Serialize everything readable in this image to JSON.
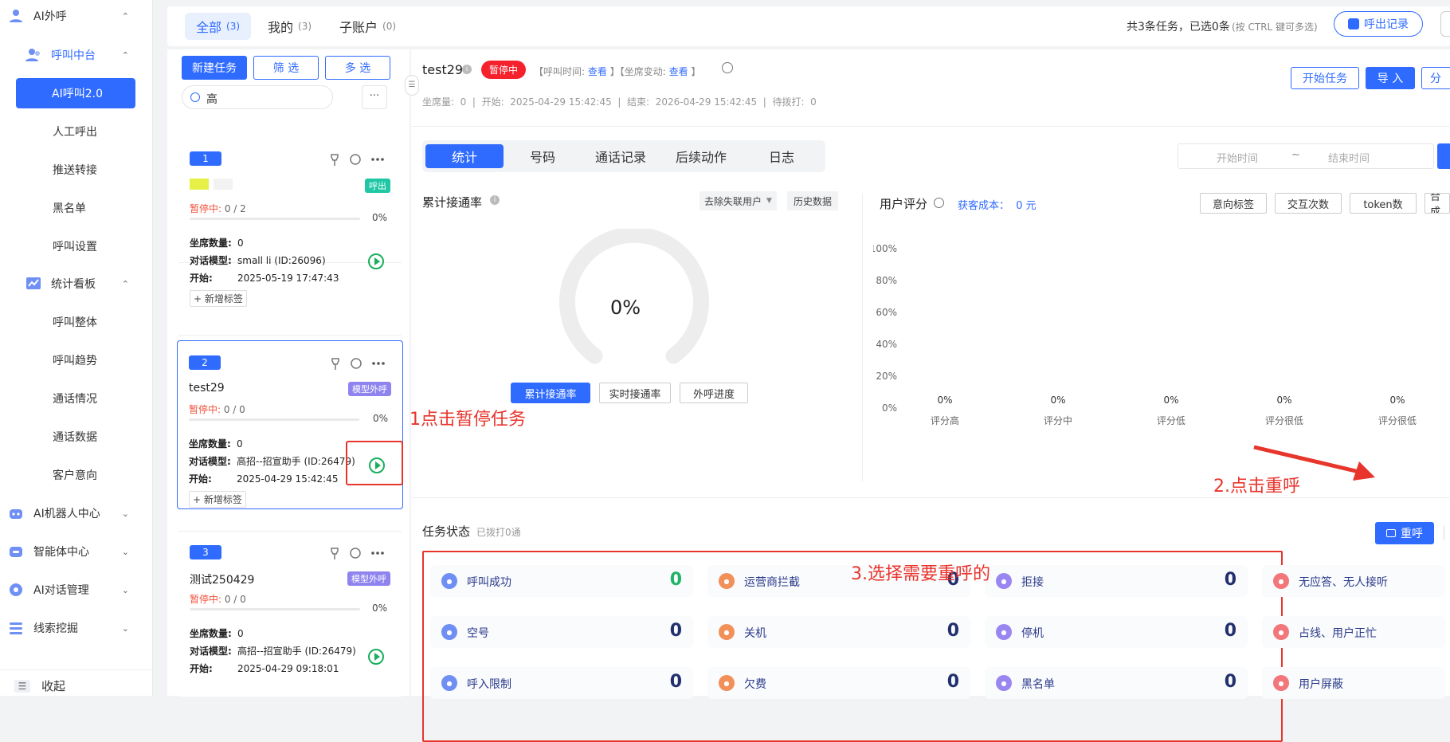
{
  "sidebar": {
    "items": [
      {
        "label": "AI外呼",
        "chev": "⌃",
        "icon": "person-icon"
      },
      {
        "label": "呼叫中台",
        "chev": "⌃",
        "icon": "people-icon"
      },
      {
        "label": "AI呼叫2.0"
      },
      {
        "label": "人工呼出"
      },
      {
        "label": "推送转接"
      },
      {
        "label": "黑名单"
      },
      {
        "label": "呼叫设置"
      },
      {
        "label": "统计看板",
        "chev": "⌃",
        "icon": "chart-icon"
      },
      {
        "label": "呼叫整体"
      },
      {
        "label": "呼叫趋势"
      },
      {
        "label": "通话情况"
      },
      {
        "label": "通话数据"
      },
      {
        "label": "客户意向"
      },
      {
        "label": "AI机器人中心",
        "chev": "⌄",
        "icon": "robot-icon"
      },
      {
        "label": "智能体中心",
        "chev": "⌄",
        "icon": "agent-icon"
      },
      {
        "label": "AI对话管理",
        "chev": "⌄",
        "icon": "dialog-icon"
      },
      {
        "label": "线索挖掘",
        "chev": "⌄",
        "icon": "mining-icon"
      }
    ],
    "collapse": "收起"
  },
  "topbar": {
    "tabs": [
      {
        "label": "全部",
        "count": "(3)"
      },
      {
        "label": "我的",
        "count": "(3)"
      },
      {
        "label": "子账户",
        "count": "(0)"
      }
    ],
    "summary": "共3条任务，已选0条",
    "hint": "(按 CTRL 键可多选)",
    "record_btn": "呼出记录"
  },
  "list": {
    "new_task": "新建任务",
    "filter": "筛 选",
    "multi": "多 选",
    "search_value": "高",
    "more": "···",
    "cards": [
      {
        "num": "1",
        "name": "",
        "tag": "呼出",
        "status_label": "暂停中:",
        "status_value": " 0 / 2",
        "pct": "0%",
        "seats_label": "坐席数量:",
        "seats": "0",
        "model_label": "对话模型:",
        "model": "small li (ID:26096)",
        "start_label": "开始:",
        "start": "2025-05-19 17:47:43",
        "addtag": "+ 新增标签"
      },
      {
        "num": "2",
        "name": "test29",
        "tag": "模型外呼",
        "status_label": "暂停中:",
        "status_value": " 0 / 0",
        "pct": "0%",
        "seats_label": "坐席数量:",
        "seats": "0",
        "model_label": "对话模型:",
        "model": "高招--招宣助手 (ID:26479)",
        "start_label": "开始:",
        "start": "2025-04-29 15:42:45",
        "addtag": "+ 新增标签"
      },
      {
        "num": "3",
        "name": "测试250429",
        "tag": "模型外呼",
        "status_label": "暂停中:",
        "status_value": " 0 / 0",
        "pct": "0%",
        "seats_label": "坐席数量:",
        "seats": "0",
        "model_label": "对话模型:",
        "model": "高招--招宣助手 (ID:26479)",
        "start_label": "开始:",
        "start": "2025-04-29 09:18:01"
      }
    ]
  },
  "detail": {
    "title": "test29",
    "state": "暂停中",
    "call_time_label": "【呼叫时间:",
    "call_time_link": "查看",
    "seat_change_label": "】【坐席变动:",
    "seat_change_link": "查看",
    "close_bracket": "】",
    "meta": "坐席量:  0  |  开始:  2025-04-29 15:42:45  |  结束:  2026-04-29 15:42:45  |  待拨打:  0",
    "btn_start": "开始任务",
    "btn_import": "导 入",
    "btn_more": "分 ",
    "tabs": [
      "统计",
      "号码",
      "通话记录",
      "后续动作",
      "日志"
    ],
    "start_placeholder": "开始时间",
    "range_sep": "~",
    "end_placeholder": "结束时间",
    "cum_title": "累计接通率",
    "remove_lost": "去除失联用户",
    "history": "历史数据",
    "gauge_value": "0%",
    "gauge_fill": 0,
    "gauge_tabs": [
      "累计接通率",
      "实时接通率",
      "外呼进度"
    ],
    "score_title": "用户评分",
    "cost": "获客成本：  0 元",
    "score_btns": [
      "意向标签",
      "交互次数",
      "token数",
      "合成"
    ]
  },
  "chart_data": {
    "type": "bar",
    "title": "用户评分",
    "categories": [
      "评分高",
      "评分中",
      "评分低",
      "评分很低",
      "评分很低"
    ],
    "values": [
      0,
      0,
      0,
      0,
      0
    ],
    "data_labels": [
      "0%",
      "0%",
      "0%",
      "0%",
      "0%"
    ],
    "yticks": [
      "100%",
      "80%",
      "60%",
      "40%",
      "20%",
      "0%"
    ],
    "ylim": [
      0,
      100
    ]
  },
  "task_status": {
    "title": "任务状态",
    "sub": "已拨打0通",
    "recall": "重呼",
    "items": [
      {
        "label": "呼叫成功",
        "value": "0",
        "color": "#6f8ff5",
        "icon": "phone-icon",
        "green": true
      },
      {
        "label": "运营商拦截",
        "value": "0",
        "color": "#f2905a",
        "icon": "block-icon"
      },
      {
        "label": "拒接",
        "value": "0",
        "color": "#9a86f0",
        "icon": "reject-icon"
      },
      {
        "label": "无应答、无人接听",
        "value": "",
        "color": "#f2767a",
        "icon": "noanswer-icon"
      },
      {
        "label": "空号",
        "value": "0",
        "color": "#6f8ff5",
        "icon": "empty-icon"
      },
      {
        "label": "关机",
        "value": "0",
        "color": "#f2905a",
        "icon": "power-icon"
      },
      {
        "label": "停机",
        "value": "0",
        "color": "#9a86f0",
        "icon": "stop-icon"
      },
      {
        "label": "占线、用户正忙",
        "value": "",
        "color": "#f2767a",
        "icon": "busy-icon"
      },
      {
        "label": "呼入限制",
        "value": "0",
        "color": "#6f8ff5",
        "icon": "limit-icon"
      },
      {
        "label": "欠费",
        "value": "0",
        "color": "#f2905a",
        "icon": "arrears-icon"
      },
      {
        "label": "黑名单",
        "value": "0",
        "color": "#9a86f0",
        "icon": "warning-icon"
      },
      {
        "label": "用户屏蔽",
        "value": "",
        "color": "#f2767a",
        "icon": "shield-icon"
      }
    ]
  },
  "annotations": {
    "a1": "1点击暂停任务",
    "a2": "2.点击重呼",
    "a3": "3.选择需要重呼的"
  }
}
